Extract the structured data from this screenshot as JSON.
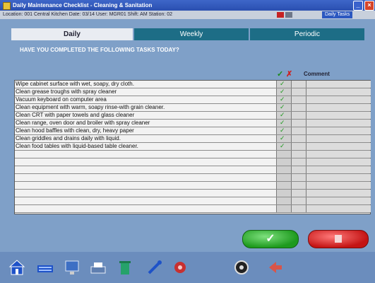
{
  "window": {
    "title": "Daily Maintenance Checklist - Cleaning & Sanitation",
    "info_text": "Location: 001 Central Kitchen    Date: 03/14    User: MGR01    Shift: AM    Station: 02",
    "user_badge": "Daily Tasks",
    "controls": {
      "minimize": "_",
      "close": "×"
    }
  },
  "tabs": [
    {
      "label": "Daily"
    },
    {
      "label": "Weekly"
    },
    {
      "label": "Periodic"
    }
  ],
  "instruction": "HAVE YOU COMPLETED THE FOLLOWING TASKS TODAY?",
  "columns": {
    "check": "✓",
    "x": "✗",
    "comment": "Comment"
  },
  "tasks": [
    {
      "text": "Wipe cabinet surface with wet, soapy, dry cloth.",
      "done": true
    },
    {
      "text": "Clean grease troughs with spray cleaner",
      "done": true
    },
    {
      "text": "Vacuum keyboard on computer area",
      "done": true
    },
    {
      "text": "Clean equipment with warm, soapy rinse-with grain cleaner.",
      "done": true
    },
    {
      "text": "Clean CRT with paper towels and glass cleaner",
      "done": true
    },
    {
      "text": "Clean range, oven door and broiler with spray cleaner",
      "done": true
    },
    {
      "text": "Clean hood baffles with clean, dry, heavy paper",
      "done": true
    },
    {
      "text": "Clean griddles and drains daily with liquid.",
      "done": true
    },
    {
      "text": "Clean food tables with liquid-based table cleaner.",
      "done": true
    },
    {
      "text": "",
      "done": false
    },
    {
      "text": "",
      "done": false
    },
    {
      "text": "",
      "done": false
    },
    {
      "text": "",
      "done": false
    },
    {
      "text": "",
      "done": false
    },
    {
      "text": "",
      "done": false
    },
    {
      "text": "",
      "done": false
    },
    {
      "text": "",
      "done": false
    }
  ],
  "buttons": {
    "ok_glyph": "✓"
  },
  "toolbar_icons": [
    "home-icon",
    "keyboard-icon",
    "computer-icon",
    "printer-icon",
    "trash-icon",
    "wrench-icon",
    "spray-icon",
    "steering-wheel-icon",
    "arrow-left-icon"
  ],
  "colors": {
    "accent": "#1d6d86",
    "ok": "#1d9a1d",
    "cancel": "#c41414",
    "background": "#7fa0c8"
  }
}
